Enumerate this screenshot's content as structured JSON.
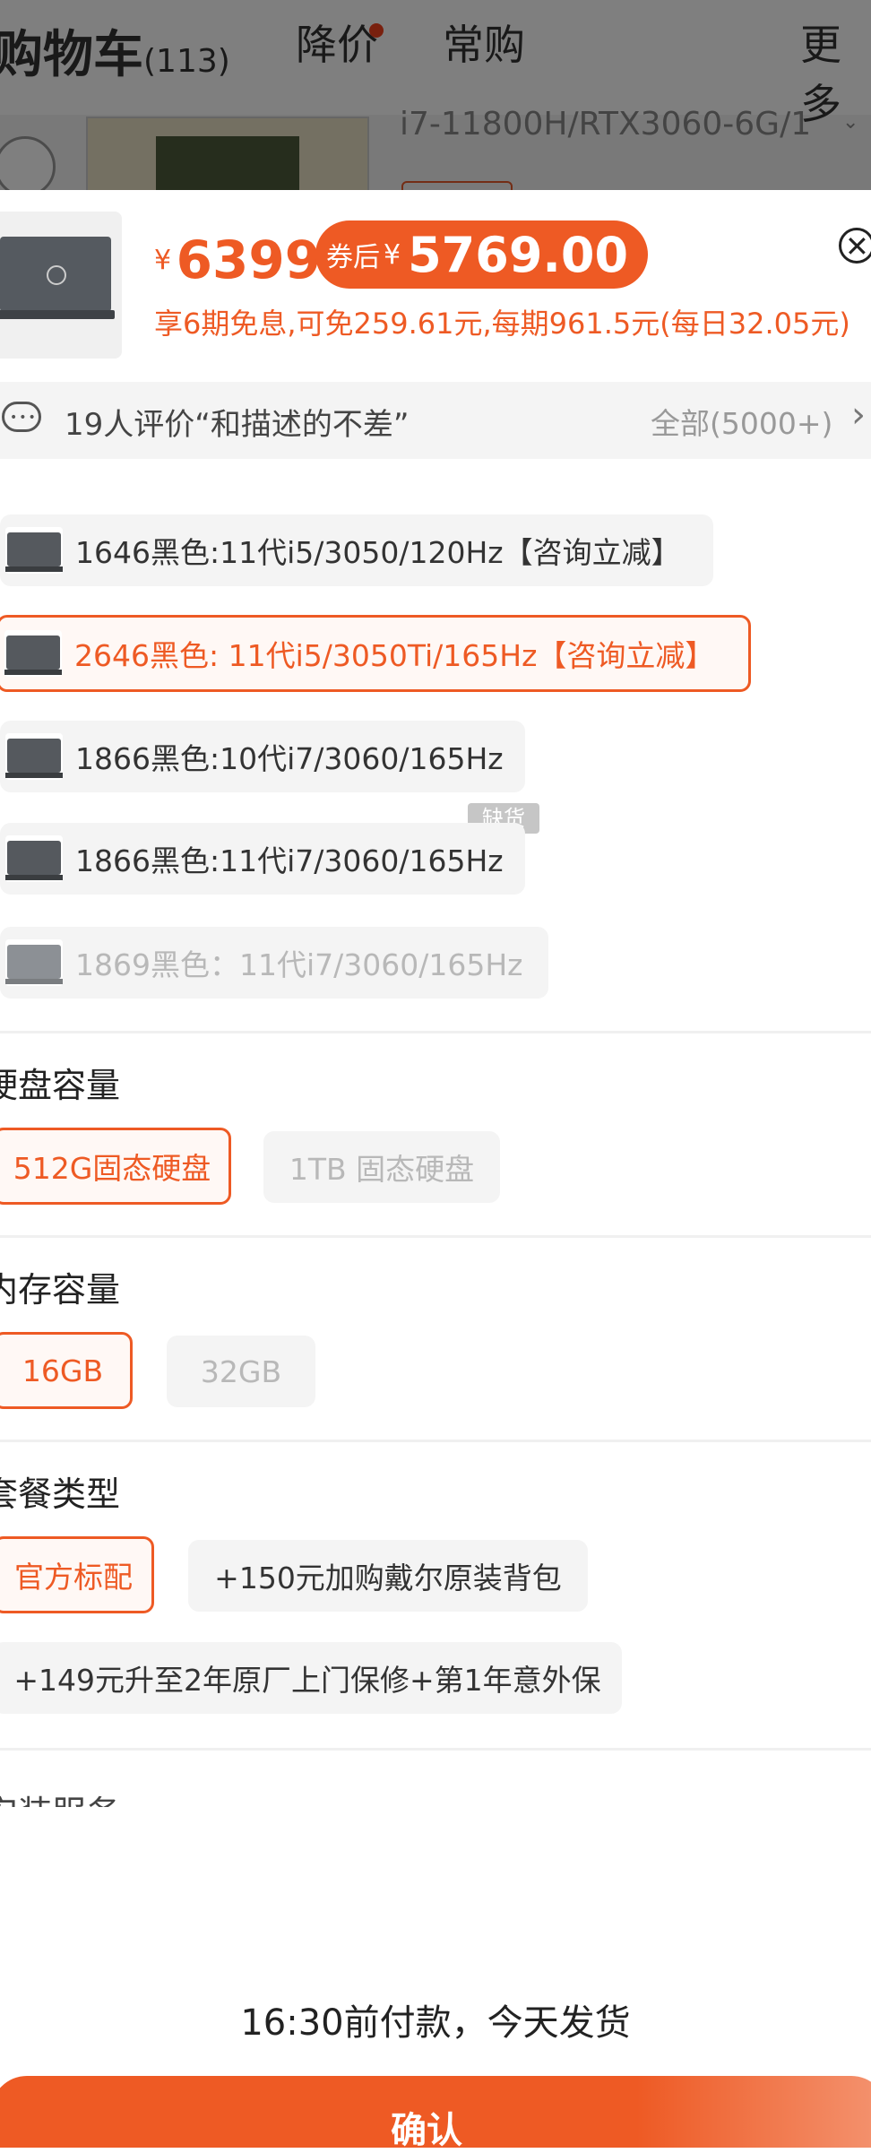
{
  "background": {
    "tabs": {
      "cart": "购物车",
      "cart_count": "(113)",
      "price_drop": "降价",
      "usual": "常购",
      "more": "更多"
    },
    "spec_text": "i7-11800H/RTX3060-6G/1"
  },
  "header": {
    "price_symbol": "¥",
    "price": "6399",
    "coupon_label": "券后",
    "coupon_symbol": "¥",
    "coupon_price": "5769.00",
    "installment": "享6期免息,可免259.61元,每期961.5元(每日32.05元)",
    "close_icon": "close-icon"
  },
  "review": {
    "text": "19人评价“和描述的不差”",
    "all_label": "全部(5000+)"
  },
  "variants": [
    {
      "label": "1646黑色:11代i5/3050/120Hz【咨询立减】",
      "state": "normal"
    },
    {
      "label": "2646黑色: 11代i5/3050Ti/165Hz【咨询立减】",
      "state": "selected"
    },
    {
      "label": "1866黑色:10代i7/3060/165Hz",
      "state": "normal"
    },
    {
      "label": "1866黑色:11代i7/3060/165Hz",
      "state": "normal"
    },
    {
      "label": "1869黑色：11代i7/3060/165Hz",
      "state": "disabled"
    }
  ],
  "out_of_stock_badge": "缺货",
  "storage": {
    "title": "硬盘容量",
    "options": [
      "512G固态硬盘",
      "1TB 固态硬盘"
    ]
  },
  "memory": {
    "title": "内存容量",
    "options": [
      "16GB",
      "32GB"
    ]
  },
  "package": {
    "title": "套餐类型",
    "options": [
      "官方标配",
      "+150元加购戴尔原装背包",
      "+149元升至2年原厂上门保修+第1年意外保"
    ]
  },
  "install_service": {
    "title": "安装服务"
  },
  "footer": {
    "pay_note": "16:30前付款，今天发货",
    "confirm": "确认"
  },
  "colors": {
    "accent": "#ee5a24",
    "chip_bg": "#f4f4f4",
    "disabled_text": "#b8b8b8"
  }
}
